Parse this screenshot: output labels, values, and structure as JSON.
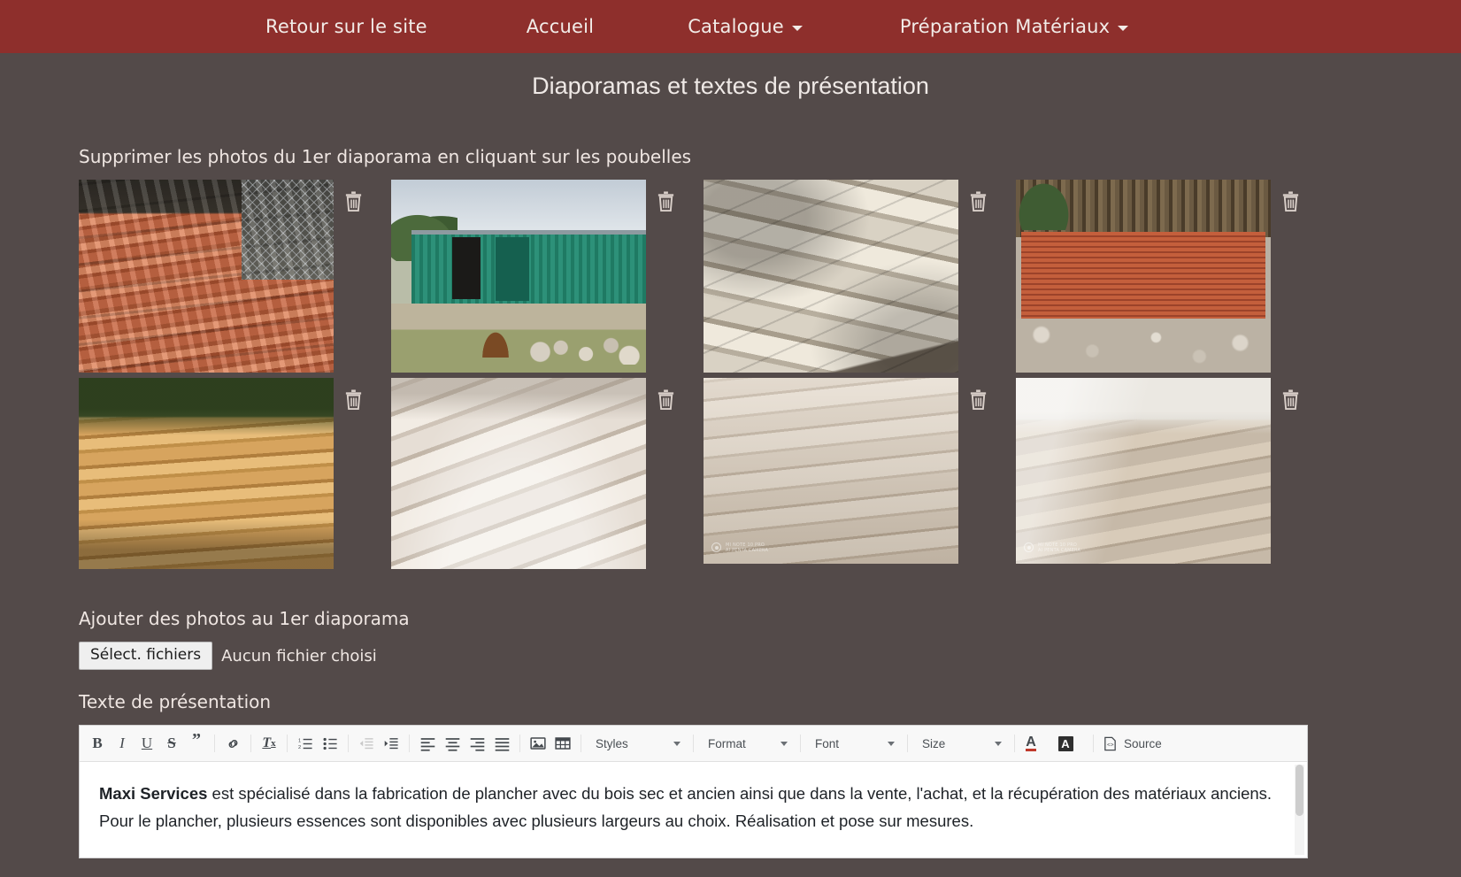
{
  "nav": {
    "items": [
      {
        "label": "Retour sur le site",
        "dropdown": false
      },
      {
        "label": "Accueil",
        "dropdown": false
      },
      {
        "label": "Catalogue",
        "dropdown": true
      },
      {
        "label": "Préparation Matériaux",
        "dropdown": true
      }
    ]
  },
  "page": {
    "title": "Diaporamas et textes de présentation"
  },
  "sections": {
    "delete_label": "Supprimer les photos du 1er diaporama en cliquant sur les poubelles",
    "add_label": "Ajouter des photos au 1er diaporama",
    "text_label": "Texte de présentation"
  },
  "gallery": {
    "trash_icon": "trash-icon",
    "photos": [
      {
        "alt": "Tuiles et briques anciennes empilées sur palette",
        "art": "ph-tiles",
        "watermark": null
      },
      {
        "alt": "Hangar vert de stockage et cour extérieure",
        "art": "ph-hangar",
        "watermark": null
      },
      {
        "alt": "Dalles et pierres de récupération empilées",
        "art": "ph-slabs",
        "watermark": null
      },
      {
        "alt": "Piles de briques rouges sur gravier devant une palissade",
        "art": "ph-bricks",
        "watermark": null
      },
      {
        "alt": "Planches de chêne séchées empilées en extérieur",
        "art": "ph-oak",
        "watermark": null
      },
      {
        "alt": "Planches de bois clair posées au sol",
        "art": "ph-pale",
        "watermark": null
      },
      {
        "alt": "Plancher bois clair posé",
        "art": "ph-floor",
        "watermark": {
          "line1": "MI NOTE 10 PRO",
          "line2": "AI PENTA CAMERA"
        }
      },
      {
        "alt": "Plancher fini et vitrifié dans une pièce",
        "art": "ph-room",
        "watermark": {
          "line1": "MI NOTE 10 PRO",
          "line2": "AI PENTA CAMERA"
        }
      }
    ]
  },
  "file_input": {
    "button_label": "Sélect. fichiers",
    "status_text": "Aucun fichier choisi"
  },
  "editor": {
    "toolbar": {
      "buttons": [
        {
          "name": "bold-icon",
          "label": "B"
        },
        {
          "name": "italic-icon",
          "label": "I"
        },
        {
          "name": "underline-icon",
          "label": "U"
        },
        {
          "name": "strikethrough-icon",
          "label": "S"
        },
        {
          "name": "blockquote-icon",
          "label": "”"
        },
        {
          "name": "link-icon",
          "label": ""
        },
        {
          "name": "remove-format-icon",
          "label": ""
        },
        {
          "name": "numbered-list-icon",
          "label": ""
        },
        {
          "name": "bulleted-list-icon",
          "label": ""
        },
        {
          "name": "outdent-icon",
          "label": ""
        },
        {
          "name": "indent-icon",
          "label": ""
        },
        {
          "name": "align-left-icon",
          "label": ""
        },
        {
          "name": "align-center-icon",
          "label": ""
        },
        {
          "name": "align-right-icon",
          "label": ""
        },
        {
          "name": "justify-icon",
          "label": ""
        },
        {
          "name": "image-icon",
          "label": ""
        },
        {
          "name": "table-icon",
          "label": ""
        }
      ],
      "combos": [
        {
          "name": "styles-dropdown",
          "label": "Styles"
        },
        {
          "name": "format-dropdown",
          "label": "Format"
        },
        {
          "name": "font-dropdown",
          "label": "Font"
        },
        {
          "name": "size-dropdown",
          "label": "Size"
        }
      ],
      "text_color_label": "A",
      "bg_color_label": "A",
      "source_label": "Source"
    },
    "content": {
      "lead": "Maxi Services",
      "body": " est spécialisé dans la fabrication de plancher avec du bois sec et ancien ainsi que dans la vente, l'achat, et la récupération des matériaux anciens. Pour le plancher, plusieurs essences sont disponibles avec plusieurs largeurs au choix. Réalisation et pose sur mesures."
    }
  },
  "colors": {
    "navbar": "#8e2f2c",
    "page_background": "#534a49",
    "text_light": "#f0e8e4",
    "editor_background": "#ffffff",
    "toolbar_background": "#f8f8f8"
  }
}
